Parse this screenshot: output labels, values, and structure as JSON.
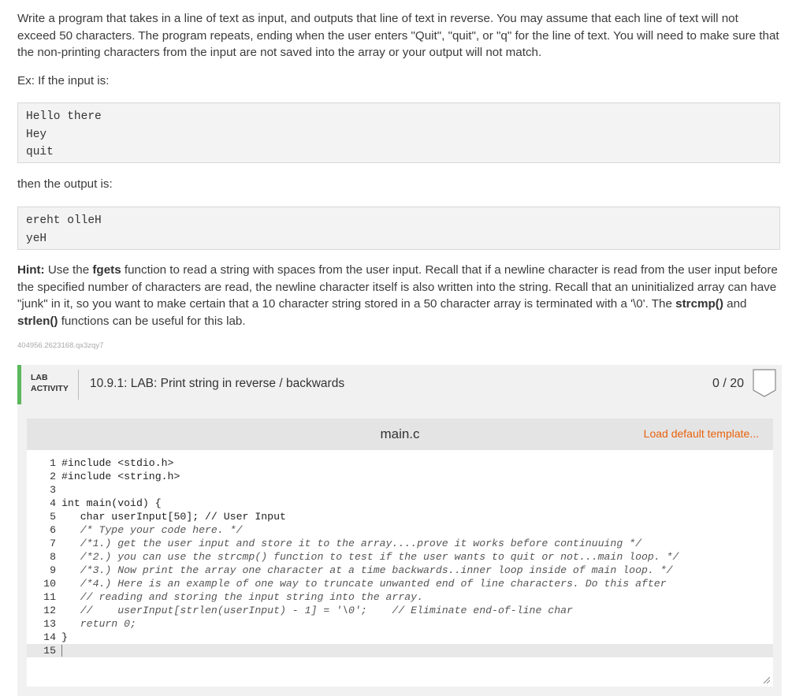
{
  "instructions": {
    "p1": "Write a program that takes in a line of text as input, and outputs that line of text in reverse. You may assume that each line of text will not exceed 50 characters. The program repeats, ending when the user enters \"Quit\", \"quit\", or \"q\" for the line of text. You will need to make sure that the non-printing characters from the input are not saved into the array or your output will not match.",
    "p2": "Ex: If the input is:",
    "input_example": [
      "Hello there",
      "Hey",
      "quit"
    ],
    "p3": "then the output is:",
    "output_example": [
      "ereht olleH",
      "yeH"
    ],
    "hint_label": "Hint:",
    "hint_a": " Use the ",
    "hint_fgets": "fgets",
    "hint_b": " function to read a string with spaces from the user input. Recall that if a newline character is read from the user input before the specified number of characters are read, the newline character itself is also written into the string. Recall that an uninitialized array can have \"junk\" in it, so you want to make certain that a 10 character string stored in a 50 character array is terminated with a '\\0'. The ",
    "hint_strcmp": "strcmp()",
    "hint_c": " and ",
    "hint_strlen": "strlen()",
    "hint_d": " functions can be useful for this lab.",
    "ref_id": "404956.2623168.qx3zqy7"
  },
  "lab": {
    "tag_line1": "LAB",
    "tag_line2": "ACTIVITY",
    "title": "10.9.1: LAB: Print string in reverse / backwards",
    "score": "0 / 20",
    "accent_color": "#5cb85c"
  },
  "editor": {
    "file_name": "main.c",
    "load_template": "Load default template...",
    "link_color": "#e8620d",
    "lines": [
      {
        "n": "1",
        "text": "#include <stdio.h>"
      },
      {
        "n": "2",
        "text": "#include <string.h>"
      },
      {
        "n": "3",
        "text": ""
      },
      {
        "n": "4",
        "text": "int main(void) {"
      },
      {
        "n": "5",
        "text": "   char userInput[50]; // User Input"
      },
      {
        "n": "6",
        "text": "   /* Type your code here. */"
      },
      {
        "n": "7",
        "text": "   /*1.) get the user input and store it to the array....prove it works before continuuing */"
      },
      {
        "n": "8",
        "text": "   /*2.) you can use the strcmp() function to test if the user wants to quit or not...main loop. */"
      },
      {
        "n": "9",
        "text": "   /*3.) Now print the array one character at a time backwards..inner loop inside of main loop. */"
      },
      {
        "n": "10",
        "text": "   /*4.) Here is an example of one way to truncate unwanted end of line characters. Do this after"
      },
      {
        "n": "11",
        "text": "   // reading and storing the input string into the array."
      },
      {
        "n": "12",
        "text": "   //    userInput[strlen(userInput) - 1] = '\\0';    // Eliminate end-of-line char"
      },
      {
        "n": "13",
        "text": "   return 0;"
      },
      {
        "n": "14",
        "text": "}"
      },
      {
        "n": "15",
        "text": ""
      }
    ]
  }
}
